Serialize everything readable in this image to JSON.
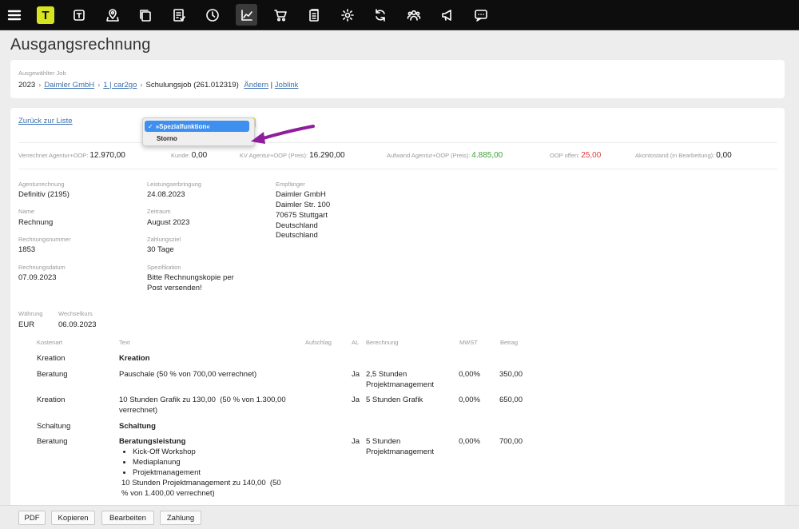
{
  "topbar": {
    "icons": [
      "menu-icon",
      "logo-icon",
      "task-icon",
      "location-icon",
      "files-icon",
      "checklist-icon",
      "clock-icon",
      "chart-icon",
      "cart-icon",
      "documents-icon",
      "settings-icon",
      "sync-icon",
      "team-icon",
      "megaphone-icon",
      "chat-icon"
    ],
    "logo_letter": "T",
    "active": "chart-icon"
  },
  "page_title": "Ausgangsrechnung",
  "job": {
    "label": "Ausgewählter Job",
    "year": "2023",
    "client": "Daimler GmbH",
    "project": "1 | car2go",
    "job_name": "Schulungsjob (261.012319)",
    "change_link": "Ändern",
    "separator": "|",
    "joblink": "Joblink"
  },
  "back_link": "Zurück zur Liste",
  "dropdown": {
    "selected_check": "✓",
    "selected": "»Spezialfunktion«",
    "options": [
      "Storno"
    ]
  },
  "stats": {
    "verrechnet_label": "Verrechnet Agentur+OOP:",
    "verrechnet_value": "12.970,00",
    "kunde_label": "Kunde:",
    "kunde_value": "0,00",
    "kv_label": "KV Agentur+OOP (Preis):",
    "kv_value": "16.290,00",
    "aufwand_label": "Aufwand Agentur+OOP (Preis):",
    "aufwand_value": "4.885,00",
    "oop_label": "OOP offen:",
    "oop_value": "25,00",
    "akonto_label": "Akontostand (in Bearbeitung):",
    "akonto_value": "0,00",
    "colors": {
      "positive": "#3aa23a",
      "negative": "#e03b3b"
    }
  },
  "details": {
    "agenturrechnung_label": "Agenturrechnung",
    "agenturrechnung_value": "Definitiv (2195)",
    "name_label": "Name",
    "name_value": "Rechnung",
    "rechnungsnummer_label": "Rechnungsnummer",
    "rechnungsnummer_value": "1853",
    "rechnungsdatum_label": "Rechnungsdatum",
    "rechnungsdatum_value": "07.09.2023",
    "leistung_label": "Leistungserbringung",
    "leistung_value": "24.08.2023",
    "zeitraum_label": "Zeitraum",
    "zeitraum_value": "August 2023",
    "zahlungsziel_label": "Zahlungsziel",
    "zahlungsziel_value": "30 Tage",
    "spezifikation_label": "Spezifikation",
    "spezifikation_line1": "Bitte Rechnungskopie per",
    "spezifikation_line2": "Post versenden!",
    "empfaenger_label": "Empfänger",
    "empfaenger_lines": [
      "Daimler GmbH",
      "Daimler Str. 100",
      "70675 Stuttgart",
      "Deutschland",
      "Deutschland"
    ],
    "waehrung_label": "Währung",
    "waehrung_value": "EUR",
    "wechselkurs_label": "Wechselkurs",
    "wechselkurs_value": "06.09.2023"
  },
  "table": {
    "headers": {
      "kostenart": "Kostenart",
      "text": "Text",
      "aufschlag": "Aufschlag",
      "al": "AL",
      "berechnung": "Berechnung",
      "mwst": "MWST",
      "betrag": "Betrag"
    },
    "rows": [
      {
        "kostenart": "Kreation",
        "text": "Kreation",
        "al": "",
        "berechnung": "",
        "mwst": "",
        "betrag": ""
      },
      {
        "kostenart": "Beratung",
        "text": "Pauschale (50 % von 700,00 verrechnet)",
        "al": "Ja",
        "berechnung_1": "2,5 Stunden",
        "berechnung_2": "Projektmanagement",
        "mwst": "0,00%",
        "betrag": "350,00"
      },
      {
        "kostenart": "Kreation",
        "text_1": "10 Stunden Grafik zu 130,00  (50 % von 1.300,00",
        "text_2": "verrechnet)",
        "al": "Ja",
        "berechnung": "5 Stunden Grafik",
        "mwst": "0,00%",
        "betrag": "650,00"
      },
      {
        "kostenart": "Schaltung",
        "text": "Schaltung",
        "al": "",
        "berechnung": "",
        "mwst": "",
        "betrag": ""
      },
      {
        "kostenart": "Beratung",
        "text_title": "Beratungsleistung",
        "bullets": [
          "Kick-Off Workshop",
          "Mediaplanung",
          "Projektmanagement"
        ],
        "text_1": "10 Stunden Projektmanagement zu 140,00  (50",
        "text_2": "% von 1.400,00 verrechnet)",
        "al": "Ja",
        "berechnung_1": "5 Stunden",
        "berechnung_2": "Projektmanagement",
        "mwst": "0,00%",
        "betrag": "700,00"
      }
    ]
  },
  "bottom_buttons": {
    "pdf": "PDF",
    "kopieren": "Kopieren",
    "bearbeiten": "Bearbeiten",
    "zahlung": "Zahlung"
  }
}
